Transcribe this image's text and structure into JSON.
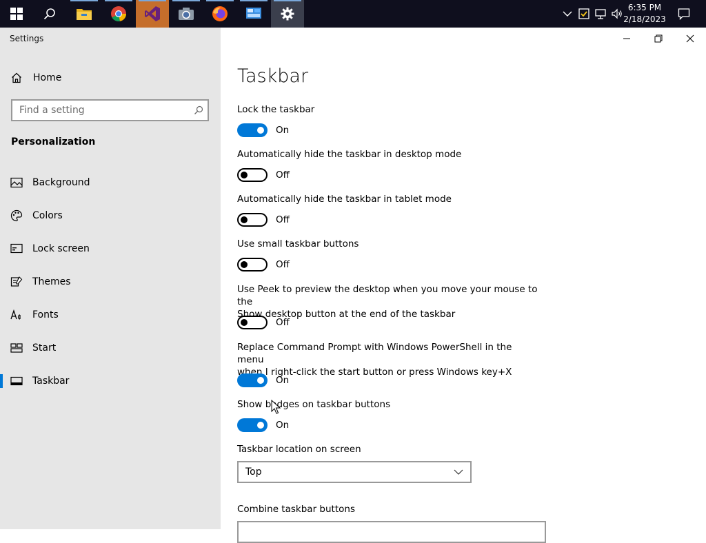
{
  "taskbar": {
    "apps": [
      {
        "name": "start-icon"
      },
      {
        "name": "search-icon"
      },
      {
        "name": "file-explorer-icon"
      },
      {
        "name": "chrome-icon"
      },
      {
        "name": "visual-studio-icon"
      },
      {
        "name": "camera-icon"
      },
      {
        "name": "firefox-icon"
      },
      {
        "name": "control-panel-icon"
      },
      {
        "name": "settings-gear-icon"
      }
    ],
    "clock_time": "6:35 PM",
    "clock_date": "2/18/2023"
  },
  "window": {
    "title": "Settings"
  },
  "sidebar": {
    "home_label": "Home",
    "search_placeholder": "Find a setting",
    "section_title": "Personalization",
    "items": [
      {
        "label": "Background",
        "icon": "picture-icon"
      },
      {
        "label": "Colors",
        "icon": "palette-icon"
      },
      {
        "label": "Lock screen",
        "icon": "lock-screen-icon"
      },
      {
        "label": "Themes",
        "icon": "themes-brush-icon"
      },
      {
        "label": "Fonts",
        "icon": "fonts-icon"
      },
      {
        "label": "Start",
        "icon": "start-tiles-icon"
      },
      {
        "label": "Taskbar",
        "icon": "taskbar-icon",
        "selected": true
      }
    ]
  },
  "main": {
    "title": "Taskbar",
    "settings": [
      {
        "label": "Lock the taskbar",
        "state": "On"
      },
      {
        "label": "Automatically hide the taskbar in desktop mode",
        "state": "Off"
      },
      {
        "label": "Automatically hide the taskbar in tablet mode",
        "state": "Off"
      },
      {
        "label": "Use small taskbar buttons",
        "state": "Off"
      },
      {
        "label_line1": "Use Peek to preview the desktop when you move your mouse to the",
        "label_line2": "Show desktop button at the end of the taskbar",
        "state": "Off"
      },
      {
        "label_line1": "Replace Command Prompt with Windows PowerShell in the menu",
        "label_line2": "when I right-click the start button or press Windows key+X",
        "state": "On"
      },
      {
        "label": "Show badges on taskbar buttons",
        "state": "On"
      }
    ],
    "location_label": "Taskbar location on screen",
    "location_value": "Top",
    "combine_label": "Combine taskbar buttons"
  },
  "colors": {
    "accent": "#0078d7",
    "sidebar_bg": "#e6e6e6",
    "taskbar_bg": "#0f0f1e"
  }
}
